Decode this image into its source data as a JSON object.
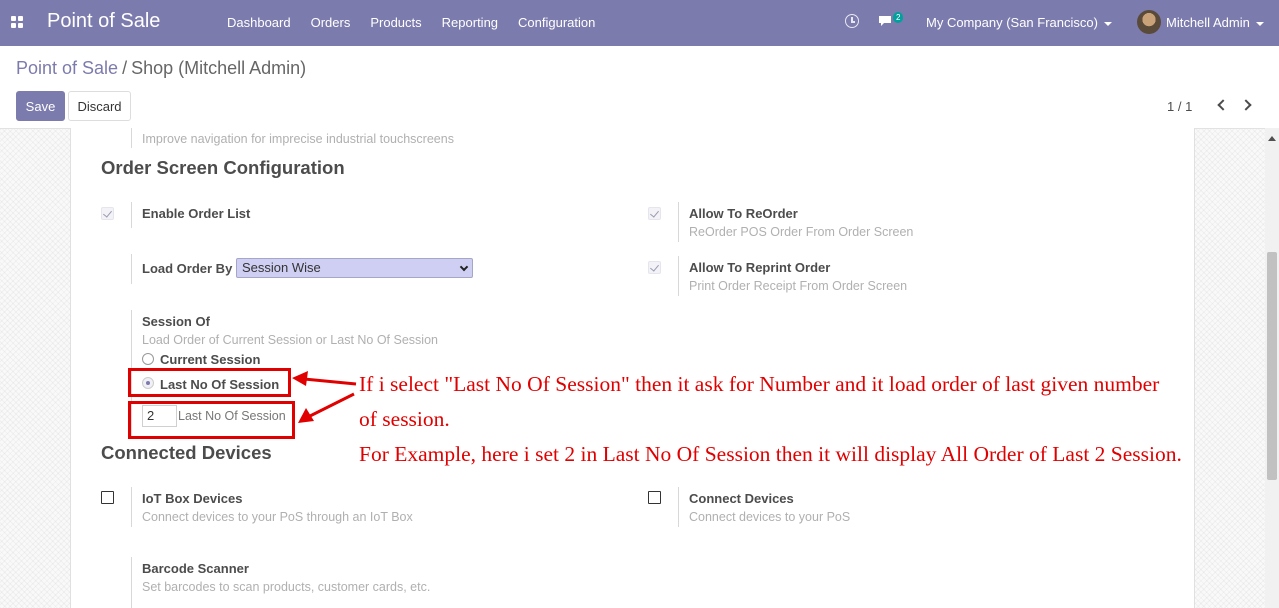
{
  "navbar": {
    "app_title": "Point of Sale",
    "menu": [
      "Dashboard",
      "Orders",
      "Products",
      "Reporting",
      "Configuration"
    ],
    "chat_count": "2",
    "company": "My Company (San Francisco)",
    "user": "Mitchell Admin",
    "icons": [
      "apps-icon",
      "clock-icon",
      "chat-icon"
    ]
  },
  "breadcrumb": {
    "parent": "Point of Sale",
    "separator": "/",
    "current": "Shop (Mitchell Admin)"
  },
  "buttons": {
    "save": "Save",
    "discard": "Discard"
  },
  "pager": {
    "value": "1 / 1"
  },
  "colors": {
    "brand": "#7c7bad",
    "annotation": "#e00000",
    "select_bg": "#cfcff3"
  },
  "settings": {
    "prev_hint": "Improve navigation for imprecise industrial touchscreens",
    "order_screen": {
      "title": "Order Screen Configuration",
      "enable_order_list": {
        "label": "Enable Order List",
        "checked": true
      },
      "allow_reorder": {
        "label": "Allow To ReOrder",
        "desc": "ReOrder POS Order From Order Screen",
        "checked": true
      },
      "load_order_by": {
        "label": "Load Order By",
        "value": "Session Wise"
      },
      "allow_reprint": {
        "label": "Allow To Reprint Order",
        "desc": "Print Order Receipt From Order Screen",
        "checked": true
      },
      "session_of": {
        "label": "Session Of",
        "desc": "Load Order of Current Session or Last No Of Session",
        "options": [
          "Current Session",
          "Last No Of Session"
        ],
        "selected": "Last No Of Session"
      },
      "last_no_of_session": {
        "value": "2",
        "label": "Last No Of Session"
      }
    },
    "connected_devices": {
      "title": "Connected Devices",
      "iot_box": {
        "label": "IoT Box Devices",
        "desc": "Connect devices to your PoS through an IoT Box",
        "checked": false
      },
      "connect_devices": {
        "label": "Connect Devices",
        "desc": "Connect devices to your PoS",
        "checked": false
      },
      "barcode": {
        "label": "Barcode Scanner",
        "desc": "Set barcodes to scan products, customer cards, etc."
      }
    }
  },
  "annotation": {
    "line1": "If i select \"Last No Of Session\" then it ask for Number and it load order of last given number",
    "line2": "of session.",
    "line3": "For Example, here i set 2 in Last No Of Session then it will display All Order of Last 2 Session."
  }
}
